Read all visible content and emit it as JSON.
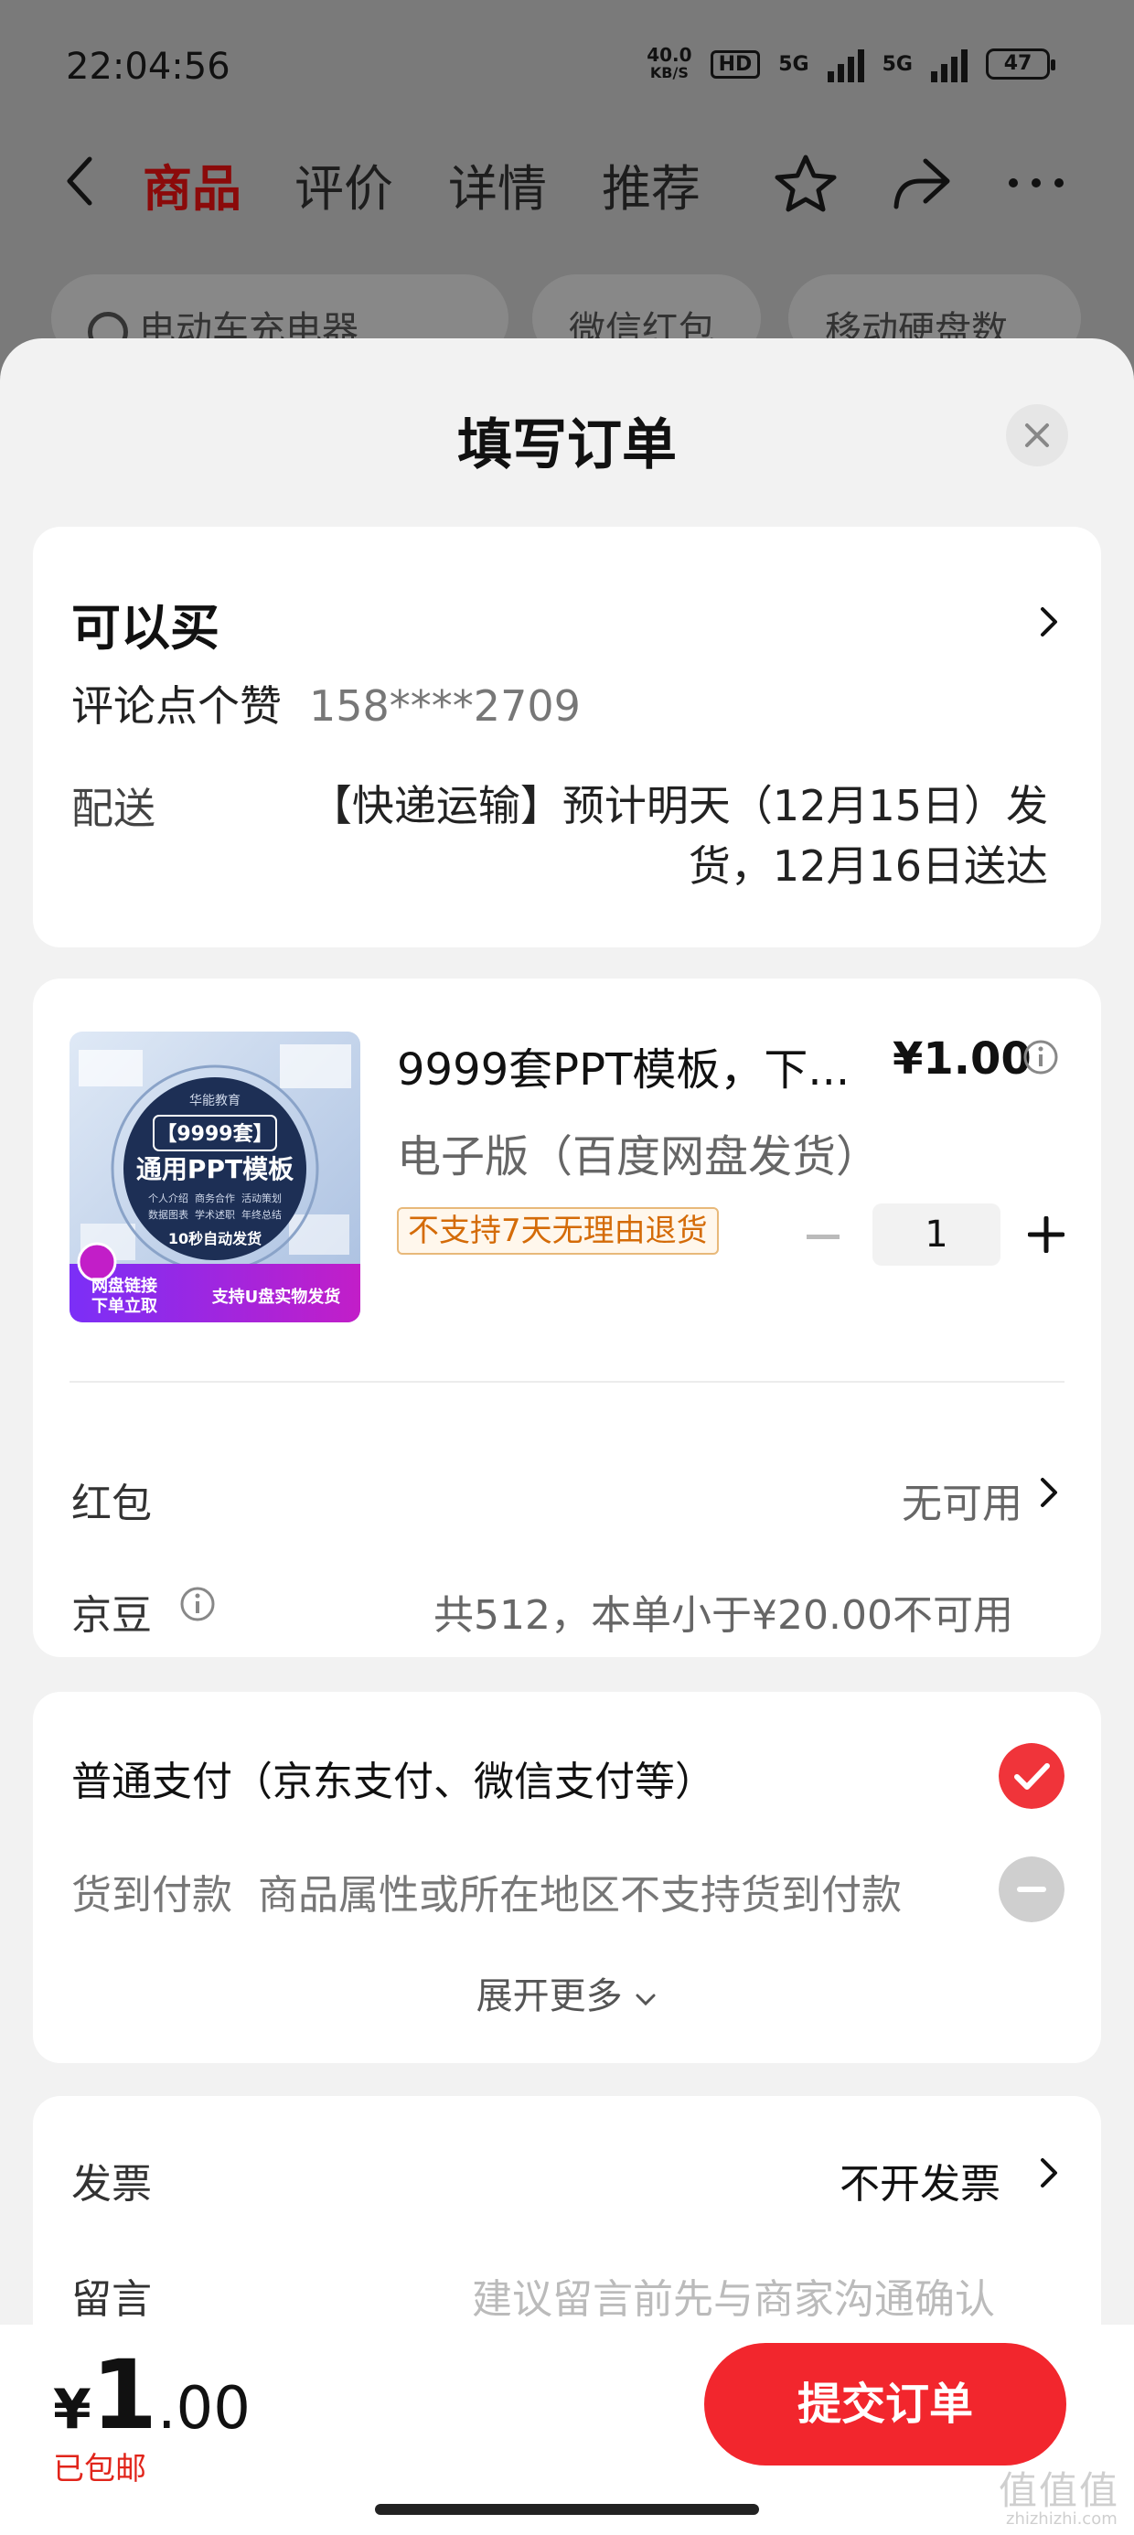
{
  "status_bar": {
    "time": "22:04:56",
    "net_speed_value": "40.0",
    "net_speed_unit": "KB/S",
    "hd_label": "HD",
    "signal1": "5G",
    "signal2": "5G",
    "battery": "47"
  },
  "nav": {
    "tabs": [
      "商品",
      "评价",
      "详情",
      "推荐"
    ],
    "active_tab": "商品"
  },
  "search": {
    "query": "电动车充电器",
    "chips": [
      "微信红包",
      "移动硬盘数"
    ]
  },
  "sheet": {
    "title": "填写订单"
  },
  "address": {
    "name": "可以买",
    "recipient": "评论点个赞",
    "phone": "158****2709",
    "ship_label": "配送",
    "ship_text": "【快递运输】预计明天（12月15日）发货，12月16日送达"
  },
  "product": {
    "title": "9999套PPT模板，下...",
    "price": "¥1.00",
    "variant": "电子版（百度网盘发货）",
    "badge": "不支持7天无理由退货",
    "quantity": "1",
    "thumb": {
      "brand": "华能教育",
      "count": "【9999套】",
      "name": "通用PPT模板",
      "features": [
        "个人介绍",
        "商务合作",
        "活动策划",
        "数据图表",
        "学术述职",
        "年终总结"
      ],
      "auto": "10秒自动发货",
      "tag_left_1": "网盘链接",
      "tag_left_2": "下单立取",
      "tag_right": "支持U盘实物发货"
    }
  },
  "discounts": {
    "redpacket_label": "红包",
    "redpacket_value": "无可用",
    "jingdou_label": "京豆",
    "jingdou_value": "共512，本单小于¥20.00不可用"
  },
  "payment": {
    "normal_label": "普通支付（京东支付、微信支付等）",
    "cod_label": "货到付款",
    "cod_note": "商品属性或所在地区不支持货到付款",
    "expand": "展开更多"
  },
  "invoice": {
    "label": "发票",
    "value": "不开发票",
    "remark_label": "留言",
    "remark_placeholder": "建议留言前先与商家沟通确认"
  },
  "bottom": {
    "yen": "¥",
    "total_int": "1",
    "total_dec": ".00",
    "shipping": "已包邮",
    "submit": "提交订单"
  },
  "watermark": {
    "text": "值值值",
    "sub": "zhizhizhi.com"
  },
  "colors": {
    "accent": "#f2262d",
    "active_tab": "#8b0a0a",
    "check": "#f0343a"
  }
}
